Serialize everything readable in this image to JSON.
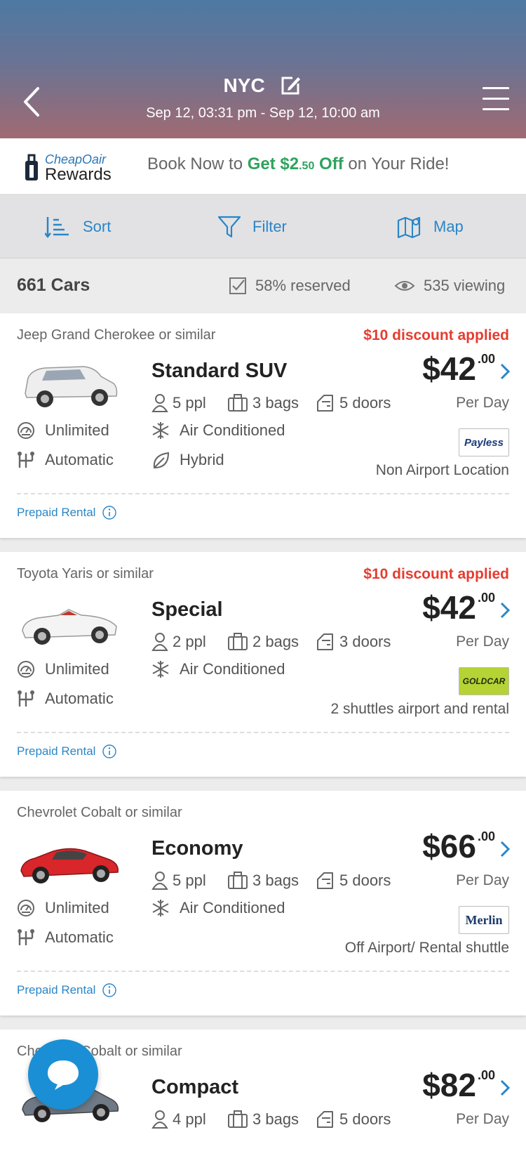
{
  "header": {
    "title": "NYC",
    "dates": "Sep 12, 03:31 pm - Sep 12, 10:00 am"
  },
  "rewards": {
    "brand": "CheapOair",
    "program": "Rewards",
    "msg_prefix": "Book Now to ",
    "offer_main": "Get $2",
    "offer_cents": ".50",
    "offer_suffix": " Off",
    "msg_suffix": " on Your Ride!",
    "accent": "#2fa35e"
  },
  "toolbar": {
    "sort": "Sort",
    "filter": "Filter",
    "map": "Map"
  },
  "stats": {
    "count": "661 Cars",
    "reserved": "58% reserved",
    "viewing": "535 viewing"
  },
  "cars": [
    {
      "model": "Jeep Grand Cherokee or similar",
      "discount": "$10 discount applied",
      "class": "Standard SUV",
      "price": "$42",
      "cents": ".00",
      "ppl": "5 ppl",
      "bags": "3 bags",
      "doors": "5 doors",
      "per": "Per Day",
      "mileage": "Unlimited",
      "ac": "Air Conditioned",
      "transmission": "Automatic",
      "fuel": "Hybrid",
      "vendor": "Payless",
      "location": "Non Airport Location",
      "prepaid": "Prepaid Rental"
    },
    {
      "model": "Toyota Yaris or similar",
      "discount": "$10 discount applied",
      "class": "Special",
      "price": "$42",
      "cents": ".00",
      "ppl": "2 ppl",
      "bags": "2 bags",
      "doors": "3 doors",
      "per": "Per Day",
      "mileage": "Unlimited",
      "ac": "Air Conditioned",
      "transmission": "Automatic",
      "vendor": "GOLDCAR",
      "location": "2 shuttles airport and rental",
      "prepaid": "Prepaid Rental"
    },
    {
      "model": "Chevrolet Cobalt or similar",
      "class": "Economy",
      "price": "$66",
      "cents": ".00",
      "ppl": "5 ppl",
      "bags": "3 bags",
      "doors": "5 doors",
      "per": "Per Day",
      "mileage": "Unlimited",
      "ac": "Air Conditioned",
      "transmission": "Automatic",
      "vendor": "Merlin",
      "location": "Off Airport/ Rental shuttle",
      "prepaid": "Prepaid Rental"
    },
    {
      "model": "Chevrolet Cobalt or similar",
      "class": "Compact",
      "price": "$82",
      "cents": ".00",
      "ppl": "4 ppl",
      "bags": "3 bags",
      "doors": "5 doors",
      "per": "Per Day"
    }
  ],
  "colors": {
    "link": "#2a86c7",
    "discount": "#e63c2f",
    "chat": "#1a8fd5"
  }
}
